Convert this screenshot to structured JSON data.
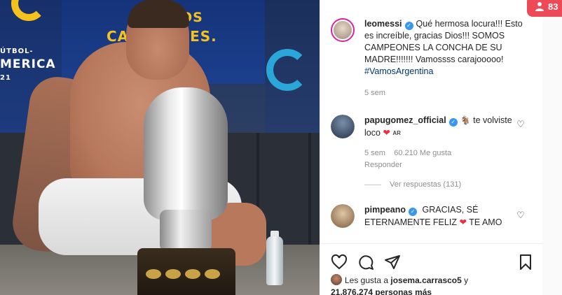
{
  "photo": {
    "banner_vamos": "VAMOS",
    "banner_campeones": "CAMPEONES.",
    "banner_futbol": "ÚTBOL-",
    "banner_america": "MERICA",
    "banner_year": "21"
  },
  "notification": {
    "icon": "person-icon",
    "count": "83"
  },
  "post": {
    "author": "leomessi",
    "caption_line1": "Qué hermosa locura!!!",
    "caption_rest": "Esto es increíble, gracias Dios!!! SOMOS CAMPEONES LA CONCHA DE SU MADRE!!!!!!! Vamossss carajooooo!",
    "hashtag": "#VamosArgentina",
    "time": "5 sem"
  },
  "comments": [
    {
      "username": "papugomez_official",
      "text_before": "te volviste loco",
      "flag": "AR",
      "time": "5 sem",
      "likes": "60.210 Me gusta",
      "reply": "Responder",
      "view_replies": "Ver respuestas (131)"
    },
    {
      "username": "pimpeano",
      "text_before": "GRACIAS, SÉ ETERNAMENTE FELIZ",
      "text_after": "TE AMO"
    }
  ],
  "actions": {
    "like_icon": "heart-icon",
    "comment_icon": "comment-icon",
    "share_icon": "send-icon",
    "save_icon": "bookmark-icon"
  },
  "likes": {
    "prefix": "Les gusta a",
    "user": "josema.carrasco5",
    "connector": "y",
    "count_text": "21.876.274 personas más"
  },
  "colors": {
    "verified": "#3897f0",
    "notification": "#ed4956",
    "heart": "#ed2f45",
    "hashtag": "#00376b"
  }
}
